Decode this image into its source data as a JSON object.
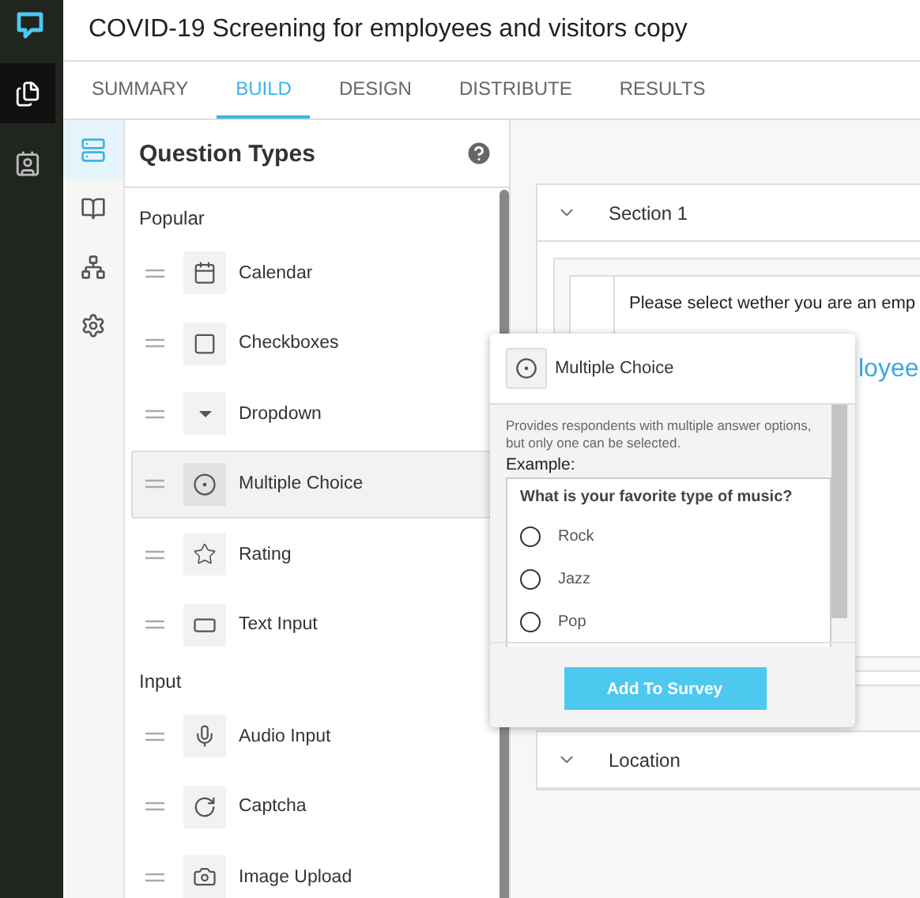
{
  "title": "COVID-19 Screening for employees and visitors copy",
  "rail": [
    {
      "kind": "surveys",
      "selected": true
    },
    {
      "kind": "contacts",
      "selected": false
    }
  ],
  "tabs": [
    {
      "label": "SUMMARY",
      "selected": false
    },
    {
      "label": "BUILD",
      "selected": true
    },
    {
      "label": "DESIGN",
      "selected": false
    },
    {
      "label": "DISTRIBUTE",
      "selected": false
    },
    {
      "label": "RESULTS",
      "selected": false
    }
  ],
  "tools": [
    {
      "kind": "questions",
      "selected": true
    },
    {
      "kind": "library",
      "selected": false
    },
    {
      "kind": "logic",
      "selected": false
    },
    {
      "kind": "settings",
      "selected": false
    }
  ],
  "panel": {
    "title": "Question Types",
    "groups": [
      {
        "title": "Popular",
        "items": [
          {
            "label": "Calendar",
            "kind": "calendar",
            "selected": false
          },
          {
            "label": "Checkboxes",
            "kind": "checkbox",
            "selected": false
          },
          {
            "label": "Dropdown",
            "kind": "dropdown",
            "selected": false
          },
          {
            "label": "Multiple Choice",
            "kind": "radio",
            "selected": true
          },
          {
            "label": "Rating",
            "kind": "star",
            "selected": false
          },
          {
            "label": "Text Input",
            "kind": "text",
            "selected": false
          }
        ]
      },
      {
        "title": "Input",
        "items": [
          {
            "label": "Audio Input",
            "kind": "mic",
            "selected": false
          },
          {
            "label": "Captcha",
            "kind": "captcha",
            "selected": false
          },
          {
            "label": "Image Upload",
            "kind": "camera",
            "selected": false
          }
        ]
      }
    ]
  },
  "popover": {
    "title": "Multiple Choice",
    "description": "Provides respondents with multiple answer options, but only one can be selected.",
    "example_label": "Example:",
    "question": "What is your favorite type of music?",
    "options": [
      {
        "label": "Rock",
        "selected": false
      },
      {
        "label": "Jazz",
        "selected": false
      },
      {
        "label": "Pop",
        "selected": false
      }
    ],
    "button": "Add To Survey"
  },
  "sections": [
    {
      "title": "Section 1",
      "question": "Please select wether you are an emp",
      "answer": "loyee"
    },
    {
      "title": "Location"
    }
  ]
}
